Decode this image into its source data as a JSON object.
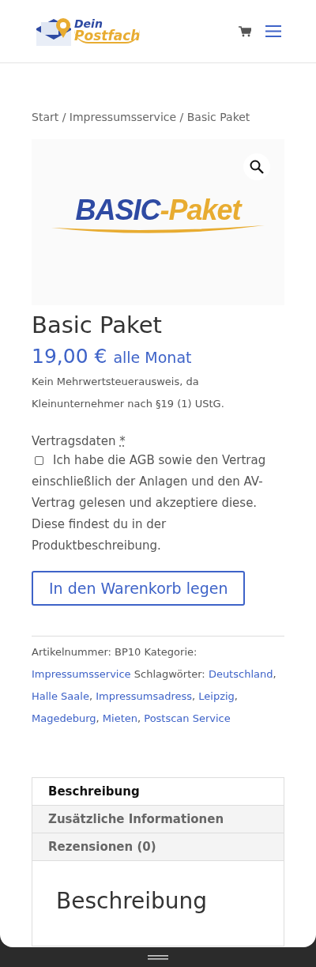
{
  "header": {
    "logo": {
      "line_1": "Dein",
      "line_2": "Postfach"
    }
  },
  "breadcrumb": {
    "separator": "/",
    "items": [
      "Start",
      "Impressumsservice",
      "Basic Paket"
    ]
  },
  "product_image": {
    "logo_part_1": "BASIC",
    "logo_part_2": "-Paket"
  },
  "product": {
    "title": "Basic Paket",
    "price": "19,00 €",
    "period": "alle Monat",
    "tax_note": "Kein Mehrwertsteuerausweis, da Kleinunternehmer nach §19 (1) UStG."
  },
  "contract": {
    "label": "Vertragsdaten",
    "required_mark": "*",
    "checkbox": {
      "checked": false,
      "label": "Ich habe die AGB sowie den Vertrag",
      "label_continued": "einschließlich der Anlagen und den AV-Vertrag gelesen und akzeptiere diese. Diese findest du in der Produktbeschreibung."
    }
  },
  "add_to_cart": "In den Warenkorb legen",
  "meta": [
    {
      "text": "Artikelnummer: BP10 Kategorie: ",
      "link": false
    },
    {
      "text": "Impressumsservice",
      "link": true
    },
    {
      "text": " Schlagwörter: ",
      "link": false
    },
    {
      "text": "Deutschland",
      "link": true
    },
    {
      "text": ", ",
      "link": false
    },
    {
      "text": "Halle Saale",
      "link": true
    },
    {
      "text": ", ",
      "link": false
    },
    {
      "text": "Impressumsadress",
      "link": true
    },
    {
      "text": ", ",
      "link": false
    },
    {
      "text": "Leipzig",
      "link": true
    },
    {
      "text": ", ",
      "link": false
    },
    {
      "text": "Magedeburg",
      "link": true
    },
    {
      "text": ", ",
      "link": false
    },
    {
      "text": "Mieten",
      "link": true
    },
    {
      "text": ", ",
      "link": false
    },
    {
      "text": "Postscan Service",
      "link": true
    }
  ],
  "tabs": [
    {
      "label": "Beschreibung",
      "selected": true
    },
    {
      "label": "Zusätzliche Informationen",
      "selected": false
    },
    {
      "label": "Rezensionen (0)",
      "selected": false
    }
  ],
  "panel": {
    "heading": "Beschreibung"
  }
}
